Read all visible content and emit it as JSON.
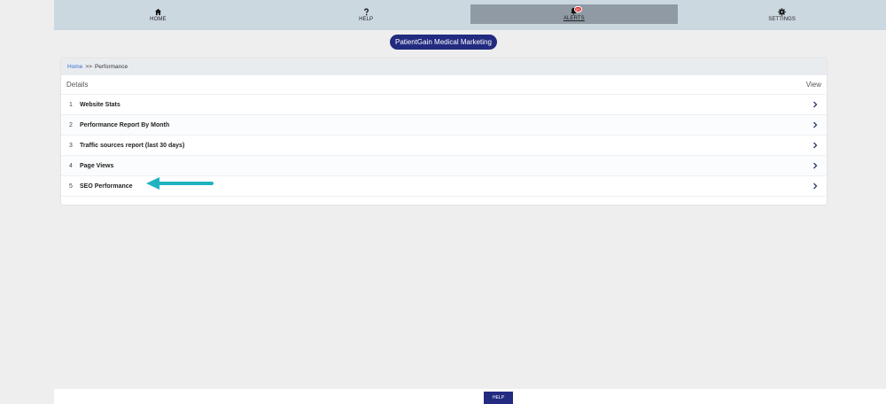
{
  "nav": {
    "items": [
      {
        "label": "HOME",
        "icon": "home-icon"
      },
      {
        "label": "HELP",
        "icon": "question-icon"
      },
      {
        "label": "ALERTS",
        "icon": "bell-icon",
        "badge": "55"
      },
      {
        "label": "SETTINGS",
        "icon": "gear-icon"
      }
    ],
    "active": "ALERTS"
  },
  "org_label": "PatientGain Medical Marketing",
  "breadcrumb": {
    "home": "Home",
    "separator": ">>",
    "current": "Performance"
  },
  "table": {
    "header_left": "Details",
    "header_right": "View",
    "rows": [
      {
        "num": "1",
        "title": "Website Stats"
      },
      {
        "num": "2",
        "title": "Performance Report By Month"
      },
      {
        "num": "3",
        "title": "Traffic sources report (last 30 days)"
      },
      {
        "num": "4",
        "title": "Page Views"
      },
      {
        "num": "5",
        "title": "SEO Performance"
      }
    ]
  },
  "annotation_color": "#1fb3c0",
  "brand_color": "#222b80",
  "footer": {
    "help_label": "HELP"
  }
}
